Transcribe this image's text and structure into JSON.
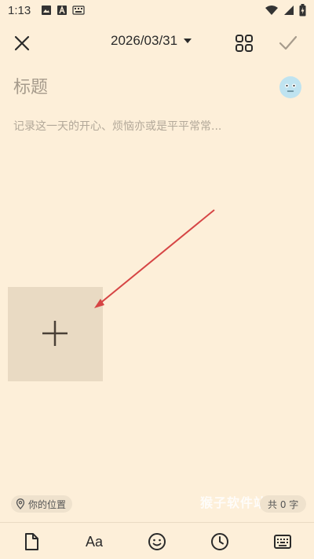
{
  "status_bar": {
    "time": "1:13"
  },
  "editor": {
    "date": "2026/03/31",
    "title_placeholder": "标题",
    "content_placeholder": "记录这一天的开心、烦恼亦或是平平常常...",
    "location_label": "你的位置",
    "word_count": "共 0 字",
    "watermark": "猴子软件站"
  },
  "toolbar": {
    "font_label": "Aa"
  },
  "icons": {
    "close": "close-icon",
    "date_dropdown": "caret-down-icon",
    "grid": "grid-icon",
    "check": "check-icon",
    "mood": "mood-face-icon",
    "add": "plus-icon",
    "location": "location-pin-icon",
    "file": "file-icon",
    "emoji": "emoji-icon",
    "clock": "clock-icon",
    "keyboard": "keyboard-icon"
  },
  "colors": {
    "background": "#FDEFD9",
    "add_tile": "#E9DAC3",
    "annotation_arrow": "#D64545",
    "mood_face": "#BFE3F0"
  }
}
